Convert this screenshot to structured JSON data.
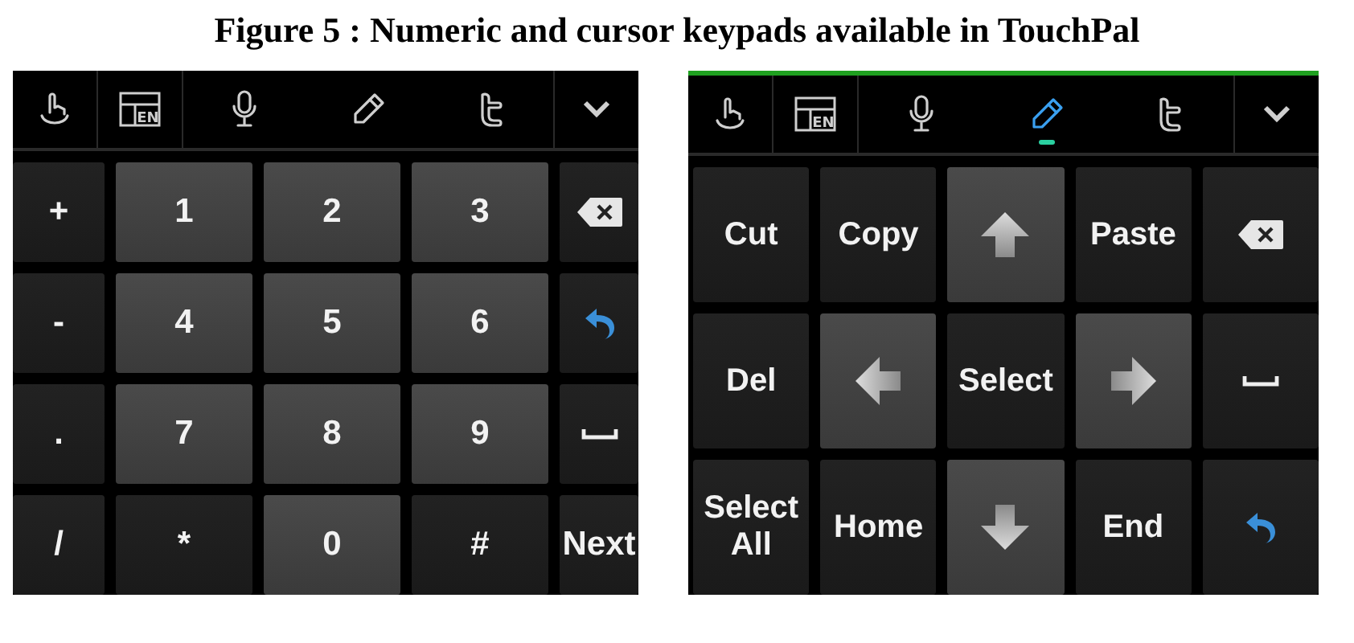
{
  "caption": "Figure 5 : Numeric and cursor keypads available in TouchPal",
  "keypads": [
    {
      "kind": "numeric",
      "highlighted": false,
      "toolbar": [
        {
          "kind": "gesture",
          "selected": false
        },
        {
          "kind": "layout",
          "badge": "EN",
          "selected": false
        },
        {
          "kind": "mic",
          "selected": false
        },
        {
          "kind": "pen",
          "selected": false
        },
        {
          "kind": "social",
          "selected": false
        },
        {
          "kind": "chevron",
          "selected": false
        }
      ],
      "keys": [
        {
          "kind": "text",
          "label": "+",
          "raised": false
        },
        {
          "kind": "text",
          "label": "1",
          "raised": true
        },
        {
          "kind": "text",
          "label": "2",
          "raised": true
        },
        {
          "kind": "text",
          "label": "3",
          "raised": true
        },
        {
          "kind": "backspace",
          "raised": false
        },
        {
          "kind": "text",
          "label": "-",
          "raised": false
        },
        {
          "kind": "text",
          "label": "4",
          "raised": true
        },
        {
          "kind": "text",
          "label": "5",
          "raised": true
        },
        {
          "kind": "text",
          "label": "6",
          "raised": true
        },
        {
          "kind": "enter",
          "raised": false
        },
        {
          "kind": "text",
          "label": ".",
          "raised": false
        },
        {
          "kind": "text",
          "label": "7",
          "raised": true
        },
        {
          "kind": "text",
          "label": "8",
          "raised": true
        },
        {
          "kind": "text",
          "label": "9",
          "raised": true
        },
        {
          "kind": "space",
          "raised": false
        },
        {
          "kind": "text",
          "label": "/",
          "raised": false
        },
        {
          "kind": "text",
          "label": "*",
          "raised": false
        },
        {
          "kind": "text",
          "label": "0",
          "raised": true
        },
        {
          "kind": "text",
          "label": "#",
          "raised": false
        },
        {
          "kind": "text",
          "label": "Next",
          "raised": false
        }
      ]
    },
    {
      "kind": "cursor",
      "highlighted": true,
      "toolbar": [
        {
          "kind": "gesture",
          "selected": false
        },
        {
          "kind": "layout",
          "badge": "EN",
          "selected": false
        },
        {
          "kind": "mic",
          "selected": false
        },
        {
          "kind": "pen",
          "selected": true
        },
        {
          "kind": "social",
          "selected": false
        },
        {
          "kind": "chevron",
          "selected": false
        }
      ],
      "keys": [
        {
          "kind": "text",
          "label": "Cut",
          "raised": false
        },
        {
          "kind": "text",
          "label": "Copy",
          "raised": false
        },
        {
          "kind": "up",
          "raised": true
        },
        {
          "kind": "text",
          "label": "Paste",
          "raised": false
        },
        {
          "kind": "backspace",
          "raised": false
        },
        {
          "kind": "text",
          "label": "Del",
          "raised": false
        },
        {
          "kind": "left",
          "raised": true
        },
        {
          "kind": "text",
          "label": "Select",
          "raised": false
        },
        {
          "kind": "right",
          "raised": true
        },
        {
          "kind": "space",
          "raised": false
        },
        {
          "kind": "text",
          "label": "Select All",
          "raised": false
        },
        {
          "kind": "text",
          "label": "Home",
          "raised": false
        },
        {
          "kind": "down",
          "raised": true
        },
        {
          "kind": "text",
          "label": "End",
          "raised": false
        },
        {
          "kind": "enter",
          "raised": false
        }
      ]
    }
  ]
}
